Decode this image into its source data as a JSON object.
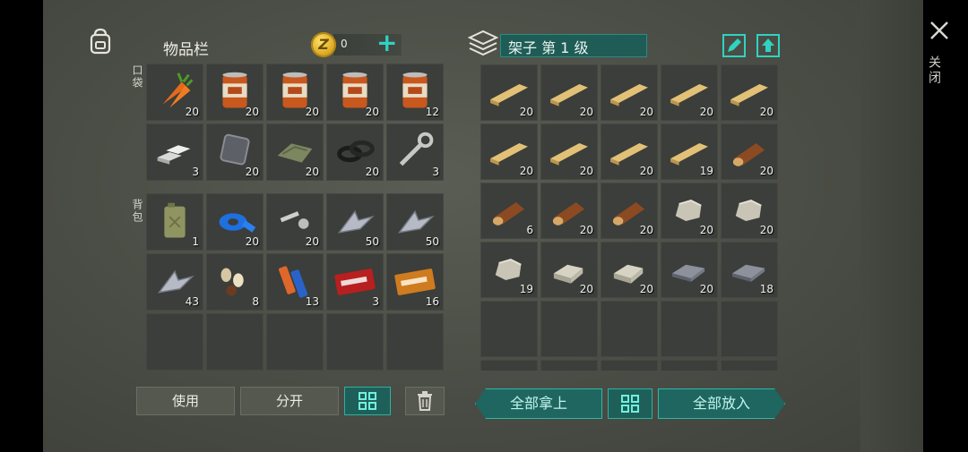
{
  "inventory": {
    "title": "物品栏",
    "coins": "0",
    "pocket_label": "口袋",
    "backpack_label": "背包",
    "pocket_items": [
      {
        "icon": "carrot-icon",
        "count": "20"
      },
      {
        "icon": "canned-food-icon",
        "count": "20"
      },
      {
        "icon": "canned-food-icon",
        "count": "20"
      },
      {
        "icon": "canned-food-icon",
        "count": "20"
      },
      {
        "icon": "canned-food-icon",
        "count": "12"
      },
      {
        "icon": "metal-bars-icon",
        "count": "3"
      },
      {
        "icon": "metal-plate-icon",
        "count": "20"
      },
      {
        "icon": "cloth-icon",
        "count": "20"
      },
      {
        "icon": "rubber-rings-icon",
        "count": "20"
      },
      {
        "icon": "wrench-icon",
        "count": "3"
      }
    ],
    "backpack_items": [
      {
        "icon": "jerrycan-icon",
        "count": "1"
      },
      {
        "icon": "duct-tape-icon",
        "count": "20"
      },
      {
        "icon": "bolt-nut-icon",
        "count": "20"
      },
      {
        "icon": "scrap-metal-icon",
        "count": "50"
      },
      {
        "icon": "scrap-metal-icon",
        "count": "50"
      },
      {
        "icon": "scrap-metal-icon",
        "count": "43"
      },
      {
        "icon": "seeds-icon",
        "count": "8"
      },
      {
        "icon": "batteries-icon",
        "count": "13"
      },
      {
        "icon": "combat-coupon-icon",
        "count": "3"
      },
      {
        "icon": "coupon-icon",
        "count": "16"
      },
      {
        "icon": "",
        "count": ""
      },
      {
        "icon": "",
        "count": ""
      },
      {
        "icon": "",
        "count": ""
      },
      {
        "icon": "",
        "count": ""
      },
      {
        "icon": "",
        "count": ""
      }
    ],
    "use_label": "使用",
    "split_label": "分开"
  },
  "storage": {
    "title": "架子 第 1 级",
    "items": [
      {
        "icon": "wood-plank-icon",
        "count": "20"
      },
      {
        "icon": "wood-plank-icon",
        "count": "20"
      },
      {
        "icon": "wood-plank-icon",
        "count": "20"
      },
      {
        "icon": "wood-plank-icon",
        "count": "20"
      },
      {
        "icon": "wood-plank-icon",
        "count": "20"
      },
      {
        "icon": "wood-plank-icon",
        "count": "20"
      },
      {
        "icon": "wood-plank-icon",
        "count": "20"
      },
      {
        "icon": "wood-plank-icon",
        "count": "20"
      },
      {
        "icon": "wood-plank-icon",
        "count": "19"
      },
      {
        "icon": "log-icon",
        "count": "20"
      },
      {
        "icon": "log-icon",
        "count": "6"
      },
      {
        "icon": "log-icon",
        "count": "20"
      },
      {
        "icon": "log-icon",
        "count": "20"
      },
      {
        "icon": "stone-icon",
        "count": "20"
      },
      {
        "icon": "stone-icon",
        "count": "20"
      },
      {
        "icon": "stone-icon",
        "count": "19"
      },
      {
        "icon": "stone-block-icon",
        "count": "20"
      },
      {
        "icon": "stone-block-icon",
        "count": "20"
      },
      {
        "icon": "iron-ingot-icon",
        "count": "20"
      },
      {
        "icon": "iron-ingot-icon",
        "count": "18"
      },
      {
        "icon": "",
        "count": ""
      },
      {
        "icon": "",
        "count": ""
      },
      {
        "icon": "",
        "count": ""
      },
      {
        "icon": "",
        "count": ""
      },
      {
        "icon": "",
        "count": ""
      },
      {
        "icon": "",
        "count": ""
      },
      {
        "icon": "",
        "count": ""
      },
      {
        "icon": "",
        "count": ""
      },
      {
        "icon": "",
        "count": ""
      },
      {
        "icon": "",
        "count": ""
      }
    ],
    "take_all_label": "全部拿上",
    "put_all_label": "全部放入"
  },
  "close_label": "关闭",
  "colors": {
    "accent": "#2fd3c2",
    "panel": "#3b3e3a",
    "background": "#4a4d45"
  }
}
